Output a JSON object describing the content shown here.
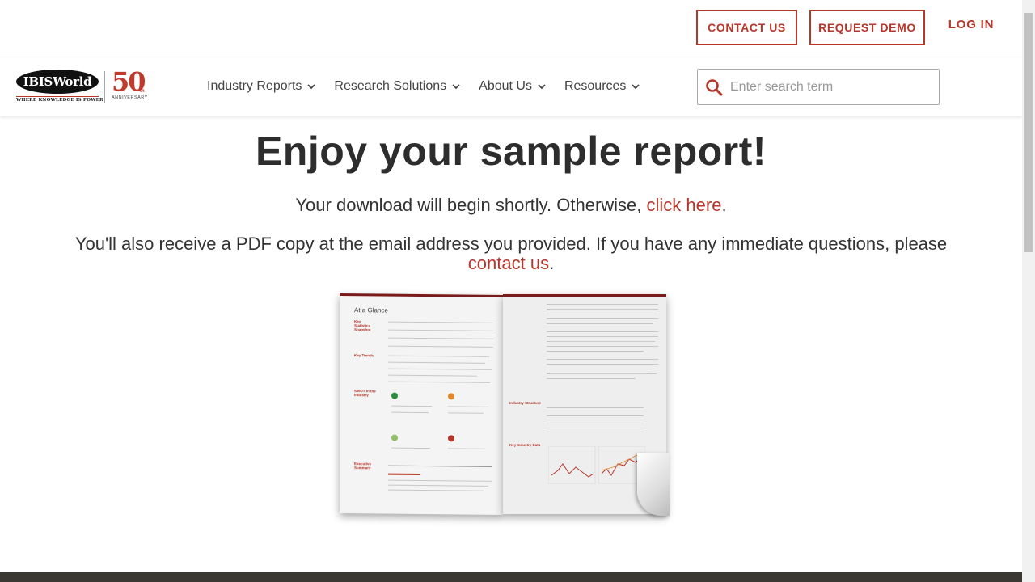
{
  "header": {
    "contact_label": "CONTACT US",
    "demo_label": "REQUEST DEMO",
    "login_label": "LOG IN"
  },
  "logo": {
    "brand": "IBISWorld",
    "tagline": "WHERE KNOWLEDGE IS POWER",
    "anniversary_number": "50",
    "anniversary_suffix": "th",
    "anniversary_label": "ANNIVERSARY"
  },
  "nav": {
    "items": [
      {
        "label": "Industry Reports"
      },
      {
        "label": "Research Solutions"
      },
      {
        "label": "About Us"
      },
      {
        "label": "Resources"
      }
    ]
  },
  "search": {
    "placeholder": "Enter search term",
    "value": ""
  },
  "main": {
    "title": "Enjoy your sample report!",
    "download_text": "Your download will begin shortly. Otherwise, ",
    "download_link": "click here",
    "download_end": ".",
    "email_text": "You'll also receive a PDF copy at the email address you provided. If you have any immediate questions, please ",
    "contact_link": "contact us",
    "contact_end": "."
  },
  "report_preview": {
    "heading": "At a Glance",
    "sections": [
      "Key Statistics Snapshot",
      "Key Trends",
      "SWOT in the Industry",
      "Executive Summary"
    ],
    "right_sections": [
      "Industry Structure",
      "Key Industry Data"
    ]
  },
  "colors": {
    "accent": "#b7362a",
    "text": "#333333"
  }
}
